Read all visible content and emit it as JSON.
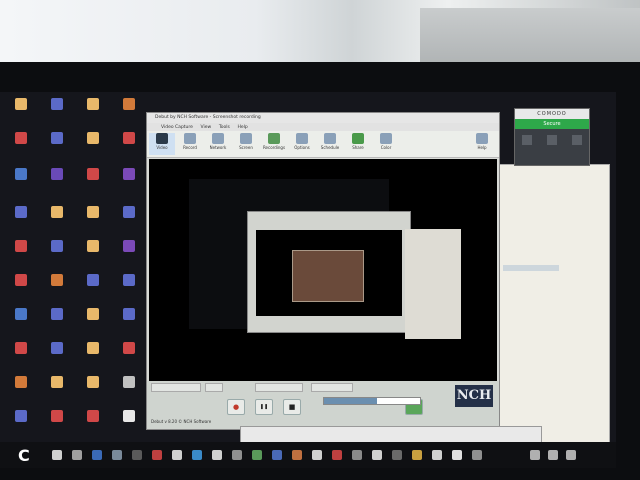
{
  "nch_window": {
    "title": "Debut by NCH Software - Screenshot recording",
    "menu": [
      "Video Capture",
      "View",
      "Tools",
      "Help"
    ],
    "toolbar": [
      "Video",
      "Record",
      "Network",
      "Screen",
      "Recordings",
      "Options",
      "Schedule",
      "Share",
      "Color",
      "Help"
    ],
    "controls": {
      "record": "●",
      "pause": "❚❚",
      "stop": "■"
    },
    "status": "Debut v 8.20 © NCH Software",
    "logo": "NCH",
    "progress": 0.55
  },
  "comodo": {
    "title": "COMODO",
    "status": "Secure"
  },
  "taskbar": {
    "start_label": "C"
  },
  "colors": {
    "record": "#c0392b",
    "secure": "#2ea84a",
    "toolbar_icon": "#8aa0b8"
  }
}
